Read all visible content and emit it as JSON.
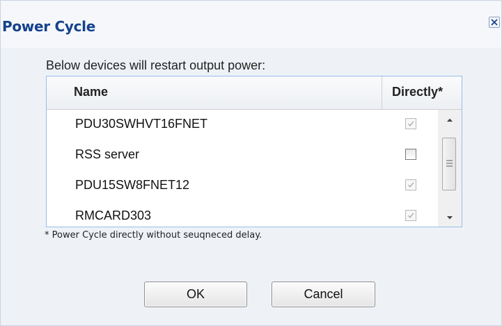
{
  "dialog": {
    "title": "Power Cycle",
    "close_icon": "close-icon"
  },
  "intro_text": "Below devices will restart output power:",
  "grid": {
    "columns": [
      "Name",
      "Directly*"
    ],
    "rows": [
      {
        "name": "PDU30SWHVT16FNET",
        "directly": true,
        "enabled": false
      },
      {
        "name": "RSS server",
        "directly": false,
        "enabled": true
      },
      {
        "name": "PDU15SW8FNET12",
        "directly": true,
        "enabled": false
      },
      {
        "name": "RMCARD303",
        "directly": true,
        "enabled": false
      }
    ]
  },
  "footnote": "* Power Cycle directly without seuqneced delay.",
  "buttons": {
    "ok": "OK",
    "cancel": "Cancel"
  },
  "colors": {
    "title": "#15428b",
    "panel_background": "#eef2f7",
    "grid_border": "#99bbe8"
  }
}
